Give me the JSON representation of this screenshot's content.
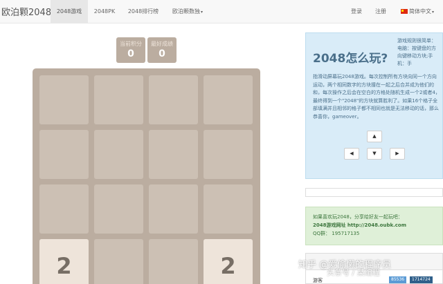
{
  "navbar": {
    "brand": "欧泊颗2048",
    "items": [
      {
        "label": "2048游戏",
        "active": true
      },
      {
        "label": "2048PK"
      },
      {
        "label": "2048排行榜"
      },
      {
        "label": "欧泊颗数独"
      }
    ],
    "login": "登录",
    "register": "注册",
    "language": "简体中文"
  },
  "scores": {
    "current_label": "当前积分",
    "current_value": "0",
    "best_label": "最好成绩",
    "best_value": "0"
  },
  "board": {
    "tiles": [
      {
        "row": 3,
        "col": 0,
        "value": "2"
      },
      {
        "row": 3,
        "col": 3,
        "value": "2"
      }
    ]
  },
  "rules": {
    "title": "2048怎么玩?",
    "side_text": "游戏规则很简单：电脑：按键盘的方向键移动方块;手机：手",
    "body_text": "指滑动屏幕玩2048游戏。每次控制所有方块向同一个方向运动，两个相同数字的方块撞在一起之后合并成为他们的和，每次操作之后会在空白的方格处随机生成一个2或者4，最终得到一个\"2048\"的方块就算胜利了。如果16个格子全部填满并且相邻的格子都不相同也就是无法移动的话，那么恭喜你，gameover。",
    "arrows": {
      "up": "▲",
      "left": "◀",
      "down": "▼",
      "right": "▶"
    }
  },
  "share": {
    "line1": "如果喜欢玩2048，分享给好友一起玩吧：",
    "line2": "2048游戏网址 http://2048.oubk.com",
    "line3": "QQ群： 195717135"
  },
  "bottom_panel": {
    "visitors_label": "游客",
    "counter_1": "85536",
    "counter_2": "1714724"
  },
  "watermark": {
    "line1": "知乎 @爱偷懒的程序员",
    "line2": "头条号 / 某编程"
  }
}
